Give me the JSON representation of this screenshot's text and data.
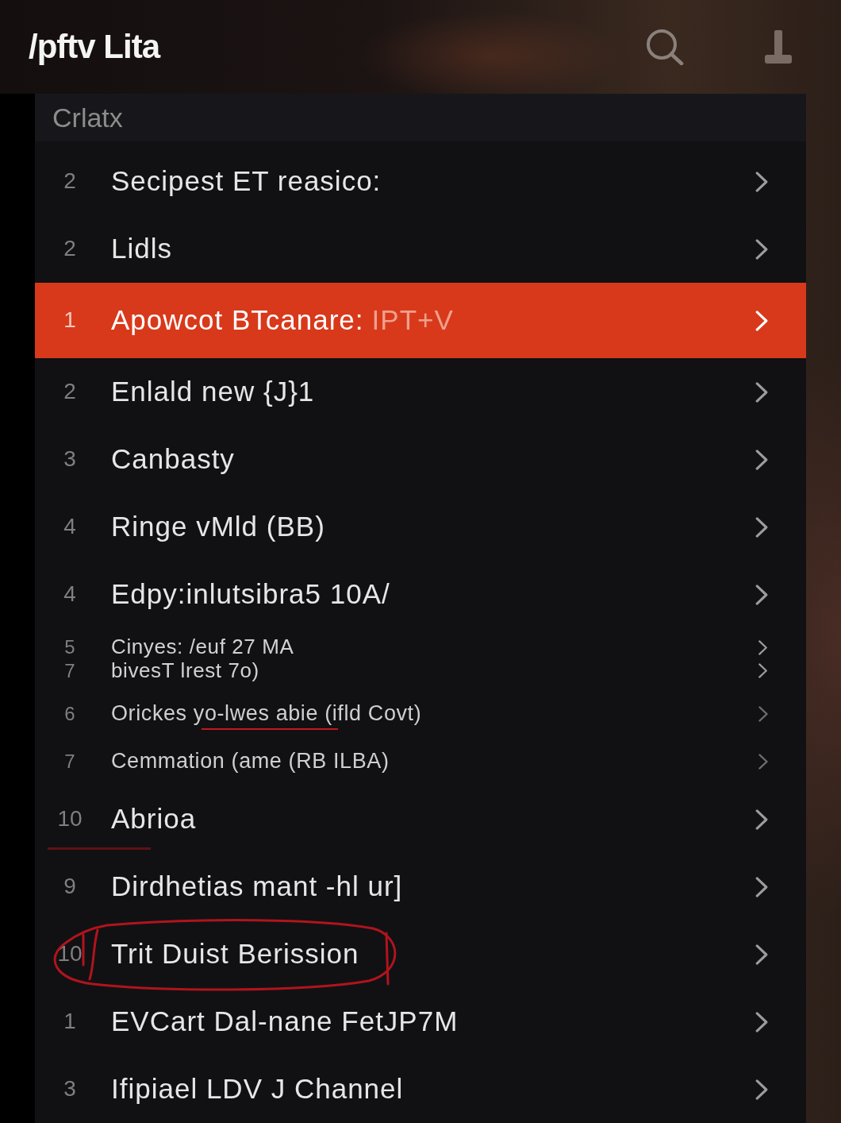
{
  "header": {
    "logo": "/pftv Lita"
  },
  "section": {
    "title": "Crlatx"
  },
  "rows": [
    {
      "kind": "large",
      "number": "2",
      "title": "Secipest ET reasico:",
      "selected": false,
      "struck": false,
      "smudge": false,
      "circled": false
    },
    {
      "kind": "large",
      "number": "2",
      "title": "Lidls",
      "selected": false,
      "struck": false,
      "smudge": false,
      "circled": false
    },
    {
      "kind": "large",
      "number": "1",
      "title": "Apowcot BTcanare:",
      "suffix": "IPT+V",
      "selected": true,
      "struck": false,
      "smudge": false,
      "circled": false
    },
    {
      "kind": "large",
      "number": "2",
      "title": "Enlald new {J}1",
      "selected": false,
      "struck": false,
      "smudge": false,
      "circled": false
    },
    {
      "kind": "large",
      "number": "3",
      "title": "Canbasty",
      "selected": false,
      "struck": false,
      "smudge": false,
      "circled": false
    },
    {
      "kind": "large",
      "number": "4",
      "title": "Ringe vMld (BB)",
      "selected": false,
      "struck": false,
      "smudge": false,
      "circled": false
    },
    {
      "kind": "large",
      "number": "4",
      "title": "Edpy:inlutsibra5 10A/",
      "selected": false,
      "struck": false,
      "smudge": false,
      "circled": false
    },
    {
      "kind": "double",
      "lines": [
        {
          "number": "5",
          "title": "Cinyes: /euf 27 MA"
        },
        {
          "number": "7",
          "title": "bivesT lrest 7o)"
        }
      ],
      "selected": false,
      "struck": false,
      "smudge": false,
      "circled": false
    },
    {
      "kind": "small",
      "number": "6",
      "title": "Orickes yo-lwes abie (ifld Covt)",
      "selected": false,
      "struck": true,
      "smudge": false,
      "circled": false
    },
    {
      "kind": "small",
      "number": "7",
      "title": "Cemmation (ame (RB ILBA)",
      "selected": false,
      "struck": false,
      "smudge": false,
      "circled": false
    },
    {
      "kind": "large",
      "number": "10",
      "title": "Abrioa",
      "selected": false,
      "struck": false,
      "smudge": true,
      "circled": false
    },
    {
      "kind": "large",
      "number": "9",
      "title": "Dirdhetias mant -hl ur]",
      "selected": false,
      "struck": false,
      "smudge": false,
      "circled": false
    },
    {
      "kind": "large",
      "number": "10",
      "title": "Trit Duist Berission",
      "selected": false,
      "struck": false,
      "smudge": false,
      "circled": true
    },
    {
      "kind": "large",
      "number": "1",
      "title": "EVCart Dal-nane FetJP7M",
      "selected": false,
      "struck": false,
      "smudge": false,
      "circled": false
    },
    {
      "kind": "large",
      "number": "3",
      "title": "Ifipiael LDV J Channel",
      "selected": false,
      "struck": false,
      "smudge": false,
      "circled": false
    }
  ]
}
